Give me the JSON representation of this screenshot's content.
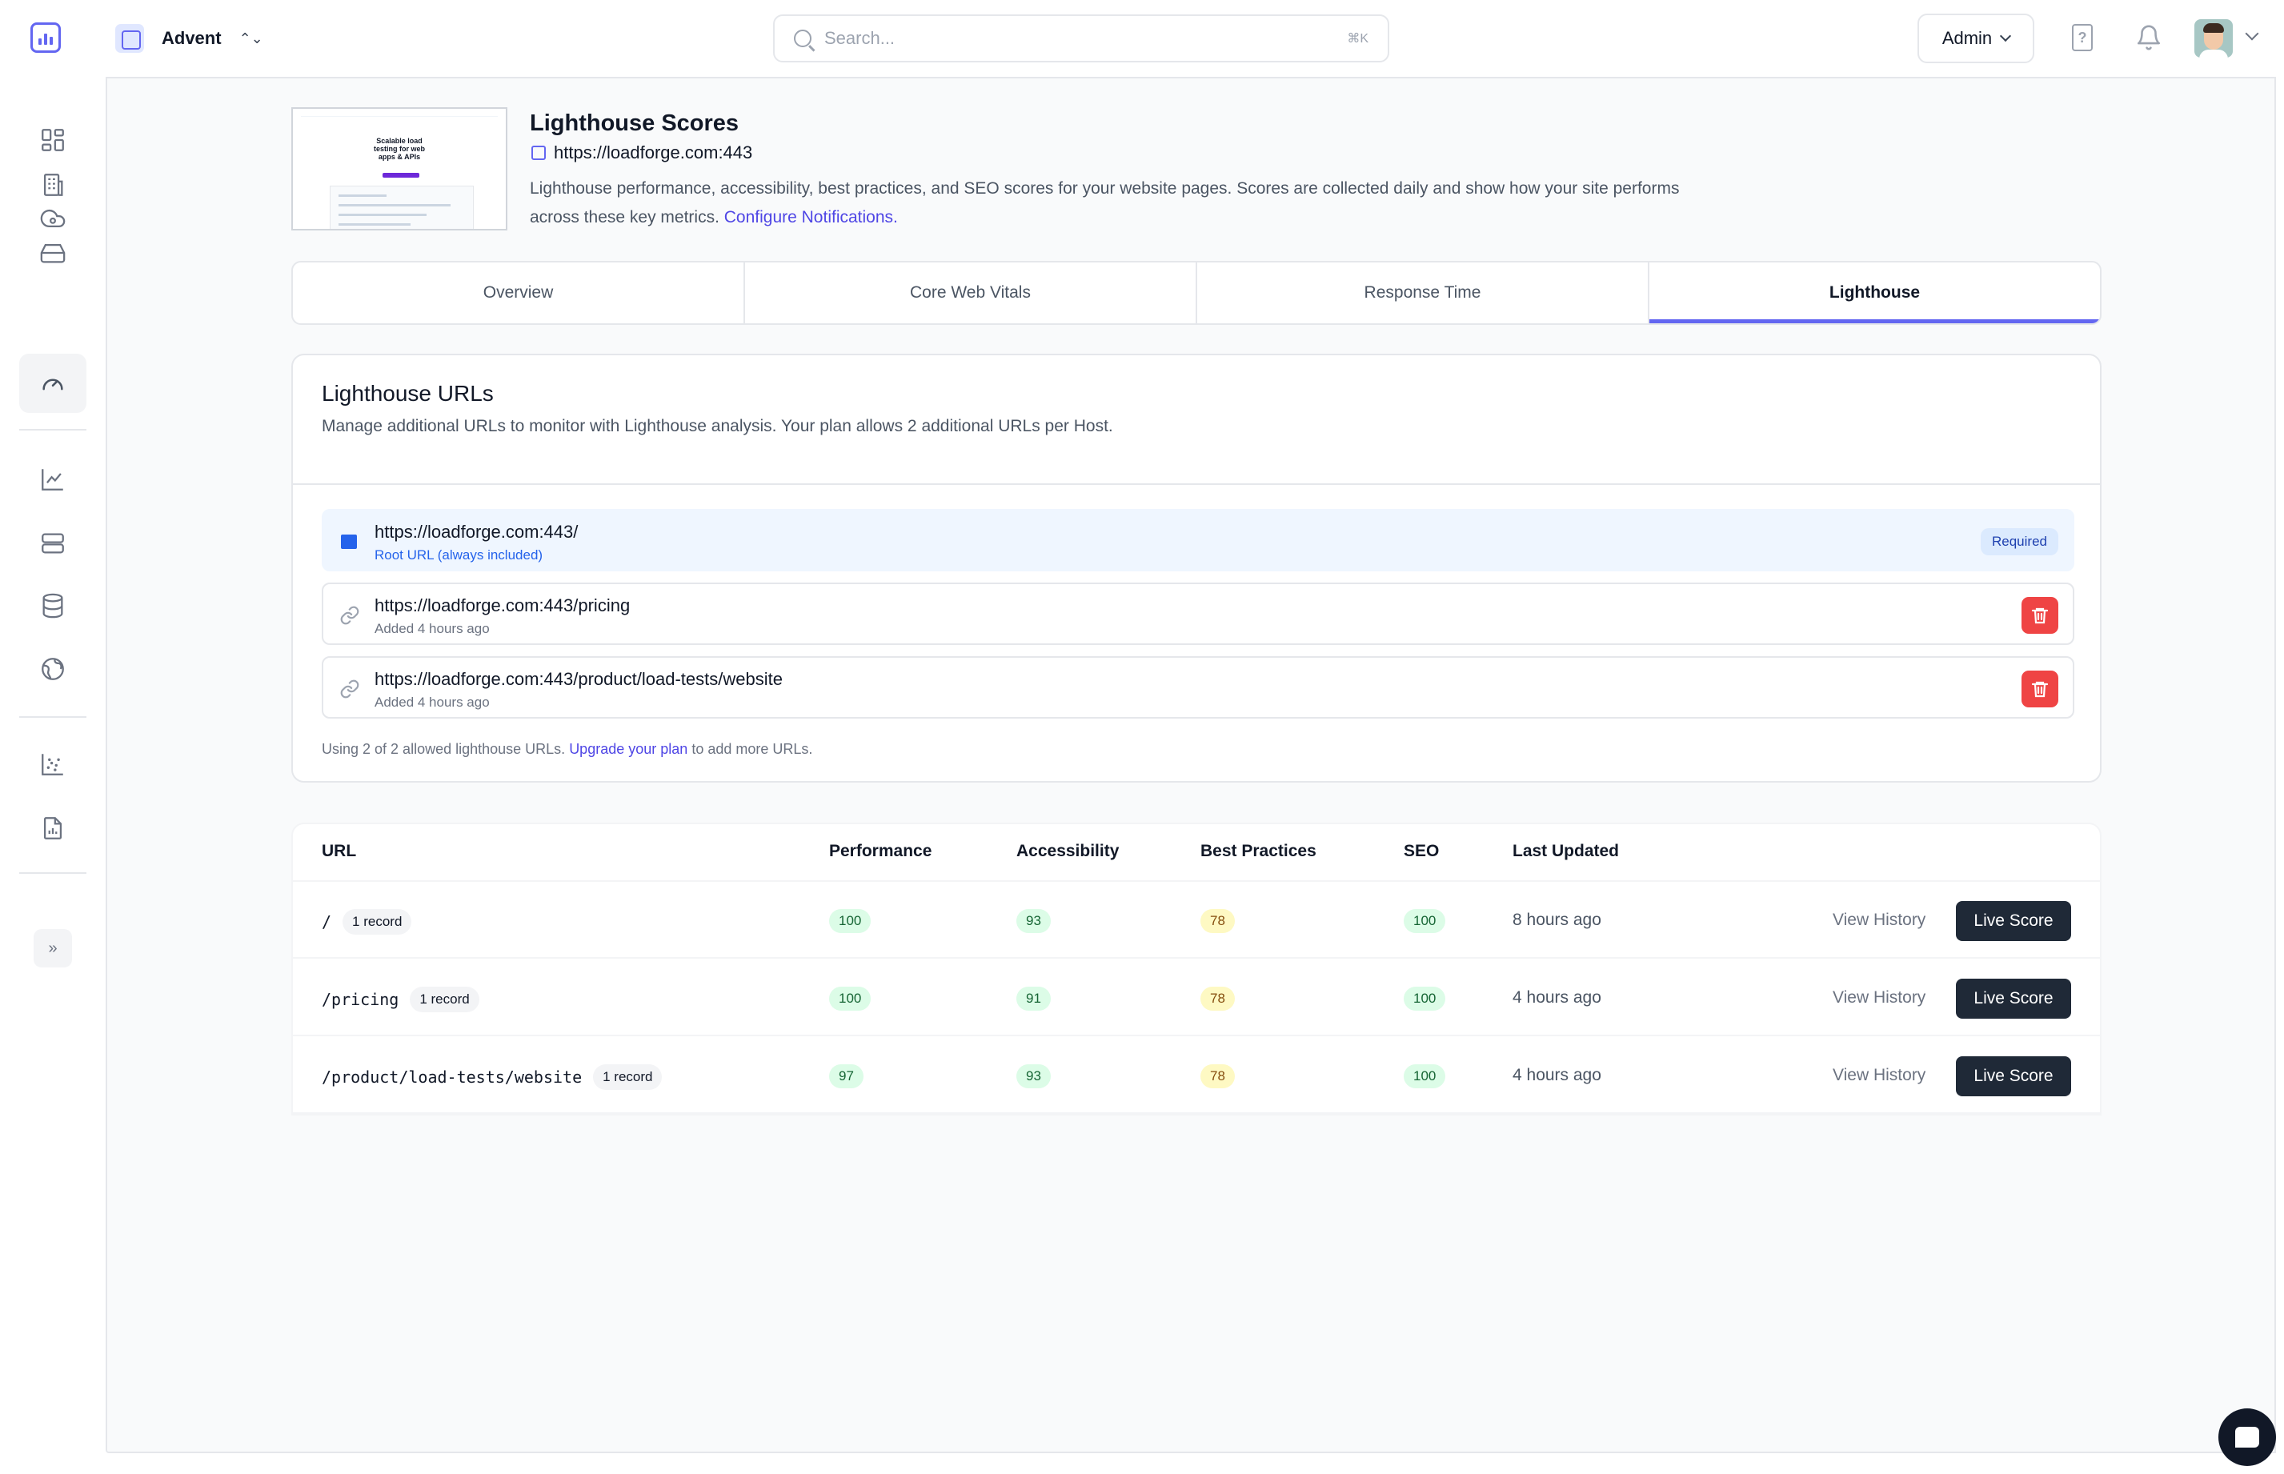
{
  "app": {
    "project_name": "Advent",
    "project_switch_glyph": "⌃⌄"
  },
  "search": {
    "placeholder": "Search...",
    "shortcut": "⌘K"
  },
  "header": {
    "admin_label": "Admin",
    "help_glyph": "?"
  },
  "sidebar": {
    "items": [
      {
        "icon": "dashboard-grid-icon",
        "active": false
      },
      {
        "icon": "building-icon",
        "active": false
      },
      {
        "icon": "cloud-icon",
        "active": false
      },
      {
        "icon": "hard-drive-icon",
        "active": false
      },
      {
        "icon": "gauge-icon",
        "active": true
      },
      {
        "icon": "line-chart-icon",
        "active": false
      },
      {
        "icon": "server-icon",
        "active": false
      },
      {
        "icon": "database-icon",
        "active": false
      },
      {
        "icon": "globe-icon",
        "active": false
      },
      {
        "icon": "scatter-chart-icon",
        "active": false
      },
      {
        "icon": "report-icon",
        "active": false
      }
    ],
    "expand_glyph": "»"
  },
  "hero": {
    "thumb_text": "Scalable load testing for web apps & APIs",
    "title": "Lighthouse Scores",
    "url": "https://loadforge.com:443",
    "description": "Lighthouse performance, accessibility, best practices, and SEO scores for your website pages. Scores are collected daily and show how your site performs across these key metrics.",
    "configure_link": "Configure Notifications."
  },
  "tabs": [
    {
      "label": "Overview",
      "active": false
    },
    {
      "label": "Core Web Vitals",
      "active": false
    },
    {
      "label": "Response Time",
      "active": false
    },
    {
      "label": "Lighthouse",
      "active": true
    }
  ],
  "urls_card": {
    "title": "Lighthouse URLs",
    "description": "Manage additional URLs to monitor with Lighthouse analysis. Your plan allows 2 additional URLs per Host.",
    "rows": [
      {
        "url": "https://loadforge.com:443/",
        "sub": "Root URL (always included)",
        "badge": "Required"
      },
      {
        "url": "https://loadforge.com:443/pricing",
        "sub": "Added 4 hours ago"
      },
      {
        "url": "https://loadforge.com:443/product/load-tests/website",
        "sub": "Added 4 hours ago"
      }
    ],
    "footer_prefix": "Using 2 of 2 allowed lighthouse URLs.",
    "footer_link": "Upgrade your plan",
    "footer_suffix": "to add more URLs."
  },
  "table": {
    "columns": [
      "URL",
      "Performance",
      "Accessibility",
      "Best Practices",
      "SEO",
      "Last Updated"
    ],
    "rows": [
      {
        "path": "/",
        "records": "1 record",
        "performance": "100",
        "accessibility": "93",
        "best_practices": "78",
        "seo": "100",
        "updated": "8 hours ago"
      },
      {
        "path": "/pricing",
        "records": "1 record",
        "performance": "100",
        "accessibility": "91",
        "best_practices": "78",
        "seo": "100",
        "updated": "4 hours ago"
      },
      {
        "path": "/product/load-tests/website",
        "records": "1 record",
        "performance": "97",
        "accessibility": "93",
        "best_practices": "78",
        "seo": "100",
        "updated": "4 hours ago"
      }
    ],
    "view_history_label": "View History",
    "live_score_label": "Live Score"
  },
  "colors": {
    "accent": "#6366f1",
    "link": "#4f46e5",
    "danger": "#ef4444",
    "score_good_bg": "#dcfce7",
    "score_average_bg": "#fef9c3",
    "button_dark": "#1f2937"
  }
}
